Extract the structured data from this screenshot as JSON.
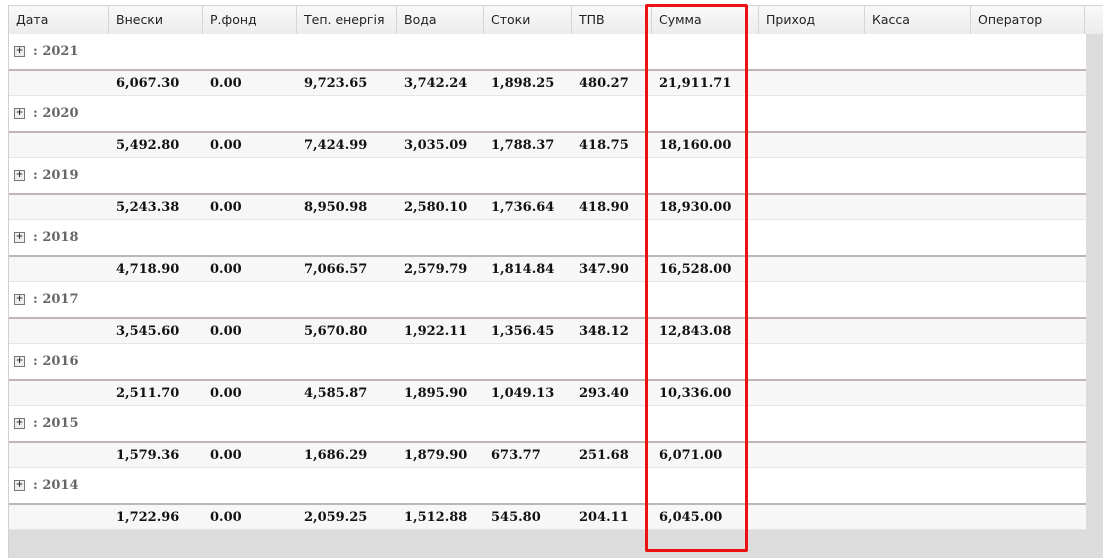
{
  "columns": [
    "Дата",
    "Внески",
    "Р.фонд",
    "Теп. енергія",
    "Вода",
    "Стоки",
    "ТПВ",
    "Сумма",
    "Приход",
    "Касса",
    "Оператор"
  ],
  "groups": [
    {
      "label": ": 2021",
      "totals": [
        "6,067.30",
        "0.00",
        "9,723.65",
        "3,742.24",
        "1,898.25",
        "480.27",
        "21,911.71"
      ]
    },
    {
      "label": ": 2020",
      "totals": [
        "5,492.80",
        "0.00",
        "7,424.99",
        "3,035.09",
        "1,788.37",
        "418.75",
        "18,160.00"
      ]
    },
    {
      "label": ": 2019",
      "totals": [
        "5,243.38",
        "0.00",
        "8,950.98",
        "2,580.10",
        "1,736.64",
        "418.90",
        "18,930.00"
      ]
    },
    {
      "label": ": 2018",
      "totals": [
        "4,718.90",
        "0.00",
        "7,066.57",
        "2,579.79",
        "1,814.84",
        "347.90",
        "16,528.00"
      ]
    },
    {
      "label": ": 2017",
      "totals": [
        "3,545.60",
        "0.00",
        "5,670.80",
        "1,922.11",
        "1,356.45",
        "348.12",
        "12,843.08"
      ]
    },
    {
      "label": ": 2016",
      "totals": [
        "2,511.70",
        "0.00",
        "4,585.87",
        "1,895.90",
        "1,049.13",
        "293.40",
        "10,336.00"
      ]
    },
    {
      "label": ": 2015",
      "totals": [
        "1,579.36",
        "0.00",
        "1,686.29",
        "1,879.90",
        "673.77",
        "251.68",
        "6,071.00"
      ]
    },
    {
      "label": ": 2014",
      "totals": [
        "1,722.96",
        "0.00",
        "2,059.25",
        "1,512.88",
        "545.80",
        "204.11",
        "6,045.00"
      ]
    }
  ],
  "highlight_color": "#ee1111"
}
